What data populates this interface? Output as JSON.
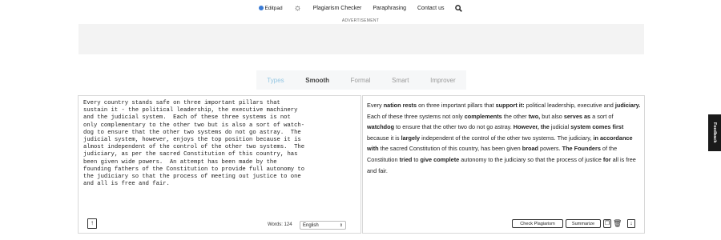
{
  "nav": {
    "logo": "Editpad",
    "links": [
      "Plagiarism Checker",
      "Paraphrasing",
      "Contact us"
    ]
  },
  "ad_label": "ADVERTISEMENT",
  "tabs": [
    "Types",
    "Smooth",
    "Formal",
    "Smart",
    "Improver"
  ],
  "input": {
    "text": "Every country stands safe on three important pillars that\nsustain it - the political leadership, the executive machinery\nand the judicial system.  Each of these three systems is not\nonly complementary to the other two but is also a sort of watch-\ndog to ensure that the other two systems do not go astray.  The\njudicial system, however, enjoys the top position because it is\nalmost independent of the control of the other two systems.  The\njudiciary, as per the sacred Constitution of this country, has\nbeen given wide powers.  An attempt has been made by the\nfounding fathers of the Constitution to provide full autonomy to\nthe judiciary so that the process of meeting out justice to one\nand all is free and fair.",
    "words_label": "Words: 124",
    "language": "English"
  },
  "output": {
    "segments": [
      {
        "t": "Every ",
        "b": false
      },
      {
        "t": "nation rests",
        "b": true
      },
      {
        "t": " on three important pillars that ",
        "b": false
      },
      {
        "t": "support it:",
        "b": true
      },
      {
        "t": " political leadership,  executive  and ",
        "b": false
      },
      {
        "t": "judiciary.",
        "b": true
      },
      {
        "t": " Each of these three systems  not only ",
        "b": false
      },
      {
        "t": "complements",
        "b": true
      },
      {
        "t": " the other ",
        "b": false
      },
      {
        "t": "two,",
        "b": true
      },
      {
        "t": " but  also ",
        "b": false
      },
      {
        "t": "serves as",
        "b": true
      },
      {
        "t": " a sort of ",
        "b": false
      },
      {
        "t": "watchdog",
        "b": true
      },
      {
        "t": " to ensure that the other two  do not go astray. ",
        "b": false
      },
      {
        "t": "However, the",
        "b": true
      },
      {
        "t": " judicial ",
        "b": false
      },
      {
        "t": "system comes first",
        "b": true
      },
      {
        "t": " because it is ",
        "b": false
      },
      {
        "t": "largely",
        "b": true
      },
      {
        "t": " independent of the control of the other two systems. The judiciary, ",
        "b": false
      },
      {
        "t": "in accordance with",
        "b": true
      },
      {
        "t": " the sacred Constitution of this country, has been given ",
        "b": false
      },
      {
        "t": "broad",
        "b": true
      },
      {
        "t": " powers. ",
        "b": false
      },
      {
        "t": "The Founders",
        "b": true
      },
      {
        "t": " of the Constitution ",
        "b": false
      },
      {
        "t": "tried",
        "b": true
      },
      {
        "t": " to ",
        "b": false
      },
      {
        "t": "give complete",
        "b": true
      },
      {
        "t": " autonomy to the judiciary so that the process of  justice ",
        "b": false
      },
      {
        "t": "for",
        "b": true
      },
      {
        "t": " all is free and fair.",
        "b": false
      }
    ],
    "check_plagiarism_label": "Check Plagiarism",
    "summarize_label": "Summarize"
  },
  "feedback_label": "Feedback"
}
